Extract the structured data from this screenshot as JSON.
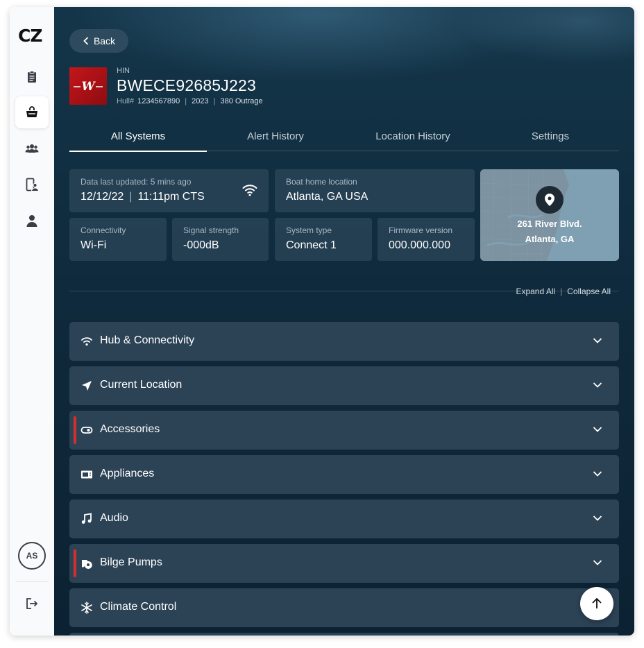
{
  "sidebar": {
    "logo": "CZ",
    "nav": [
      {
        "name": "clipboard-icon",
        "active": false
      },
      {
        "name": "boat-icon",
        "active": true
      },
      {
        "name": "users-icon",
        "active": false
      },
      {
        "name": "device-user-icon",
        "active": false
      },
      {
        "name": "person-icon",
        "active": false
      }
    ],
    "avatar_initials": "AS",
    "logout_icon": "logout-icon"
  },
  "header": {
    "back_label": "Back",
    "hin_label": "HIN",
    "hin_value": "BWECE92685J223",
    "hull_label": "Hull#",
    "hull_number": "1234567890",
    "year": "2023",
    "model": "380 Outrage",
    "brand_color": "#c4161c"
  },
  "tabs": [
    {
      "label": "All Systems",
      "active": true
    },
    {
      "label": "Alert History",
      "active": false
    },
    {
      "label": "Location History",
      "active": false
    },
    {
      "label": "Settings",
      "active": false
    }
  ],
  "info": {
    "last_updated_label": "Data last updated: 5 mins ago",
    "last_updated_date": "12/12/22",
    "last_updated_time": "11:11pm CTS",
    "home_location_label": "Boat home location",
    "home_location_value": "Atlanta, GA USA",
    "connectivity_label": "Connectivity",
    "connectivity_value": "Wi-Fi",
    "signal_label": "Signal strength",
    "signal_value": "-000dB",
    "system_type_label": "System type",
    "system_type_value": "Connect 1",
    "firmware_label": "Firmware version",
    "firmware_value": "000.000.000"
  },
  "map": {
    "address_line1": "261 River Blvd.",
    "address_line2": "Atlanta, GA"
  },
  "controls": {
    "expand_all": "Expand All",
    "collapse_all": "Collapse All"
  },
  "systems": [
    {
      "title": "Hub & Connectivity",
      "icon": "wifi-icon",
      "alert": false
    },
    {
      "title": "Current Location",
      "icon": "navigation-arrow-icon",
      "alert": false
    },
    {
      "title": "Accessories",
      "icon": "toggle-icon",
      "alert": true
    },
    {
      "title": "Appliances",
      "icon": "microwave-icon",
      "alert": false
    },
    {
      "title": "Audio",
      "icon": "music-note-icon",
      "alert": false
    },
    {
      "title": "Bilge Pumps",
      "icon": "pump-icon",
      "alert": true
    },
    {
      "title": "Climate Control",
      "icon": "snowflake-icon",
      "alert": false
    }
  ],
  "colors": {
    "alert": "#d32f2f",
    "panel_bg": "#2c4356",
    "page_bg": "#0f2a3c"
  },
  "scroll_top_icon": "arrow-up-icon"
}
